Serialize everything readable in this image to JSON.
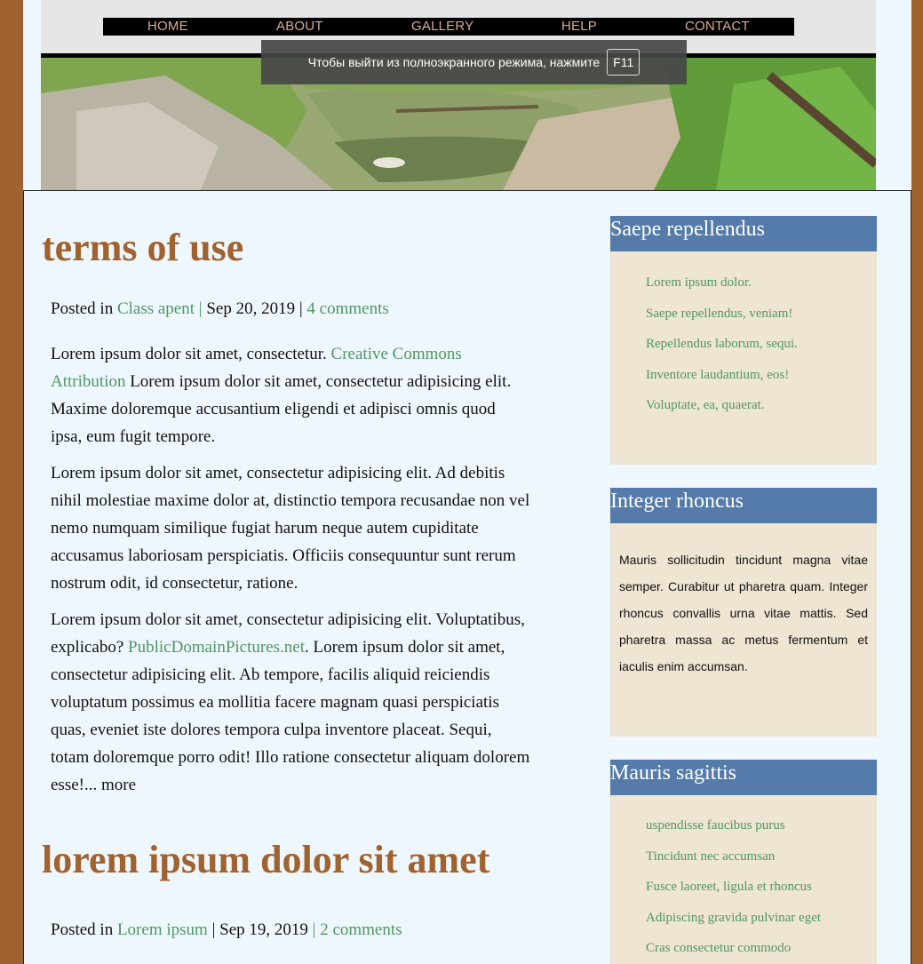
{
  "nav": {
    "items": [
      "HOME",
      "ABOUT",
      "GALLERY",
      "HELP",
      "CONTACT"
    ]
  },
  "fullscreen_notice": {
    "text": "Чтобы выйти из полноэкранного режима, нажмите",
    "key": "F11"
  },
  "posts": [
    {
      "title": "terms of use",
      "posted_in_label": "Posted in",
      "category": "Class apent",
      "date": "Sep 20, 2019",
      "comments": "4 comments",
      "p1_a": "Lorem ipsum dolor sit amet, consectetur.",
      "p1_link": "Creative Commons Attribution",
      "p1_b": "Lorem ipsum dolor sit amet, consectetur adipisicing elit. Maxime doloremque accusantium eligendi et adipisci omnis quod ipsa, eum fugit tempore.",
      "p2": "Lorem ipsum dolor sit amet, consectetur adipisicing elit. Ad debitis nihil molestiae maxime dolor at, distinctio tempora recusandae non vel nemo numquam similique fugiat harum neque autem cupiditate accusamus laboriosam perspiciatis. Officiis consequuntur sunt rerum nostrum odit, id consectetur, ratione.",
      "p3_a": "Lorem ipsum dolor sit amet, consectetur adipisicing elit. Voluptatibus, explicabo?",
      "p3_link": "PublicDomainPictures.net",
      "p3_b": ". Lorem ipsum dolor sit amet, consectetur adipisicing elit. Ab tempore, facilis aliquid reiciendis voluptatum possimus ea mollitia facere magnam quasi perspiciatis quas, eveniet iste dolores tempora culpa inventore placeat. Sequi, totam doloremque porro odit! Illo ratione consectetur aliquam dolorem esse!... more"
    },
    {
      "title": "lorem ipsum dolor sit amet",
      "posted_in_label": "Posted in",
      "category": "Lorem ipsum",
      "date": "Sep 19, 2019",
      "comments": "2 comments"
    }
  ],
  "sidebar": [
    {
      "title": "Saepe repellendus",
      "links": [
        "Lorem ipsum dolor.",
        "Saepe repellendus, veniam!",
        "Repellendus laborum, sequi.",
        "Inventore laudantium, eos!",
        "Voluptate, ea, quaerat."
      ]
    },
    {
      "title": "Integer rhoncus",
      "text": "Mauris sollicitudin tincidunt magna vitae semper. Curabitur ut pharetra quam. Integer rhoncus convallis urna vitae mattis. Sed pharetra massa ac metus fermentum et iaculis enim accumsan."
    },
    {
      "title": "Mauris sagittis",
      "links": [
        "uspendisse faucibus purus",
        "Tincidunt nec accumsan",
        "Fusce laoreet, ligula et rhoncus",
        "Adipiscing gravida pulvinar eget",
        "Cras consectetur commodo"
      ]
    }
  ],
  "colors": {
    "outer_bg": "#a0622e",
    "page_bg": "#eef7fd",
    "title": "#a0622e",
    "link": "#4f9660",
    "sidebar_head": "#547ba9",
    "sidebar_body": "#efe5d3"
  }
}
